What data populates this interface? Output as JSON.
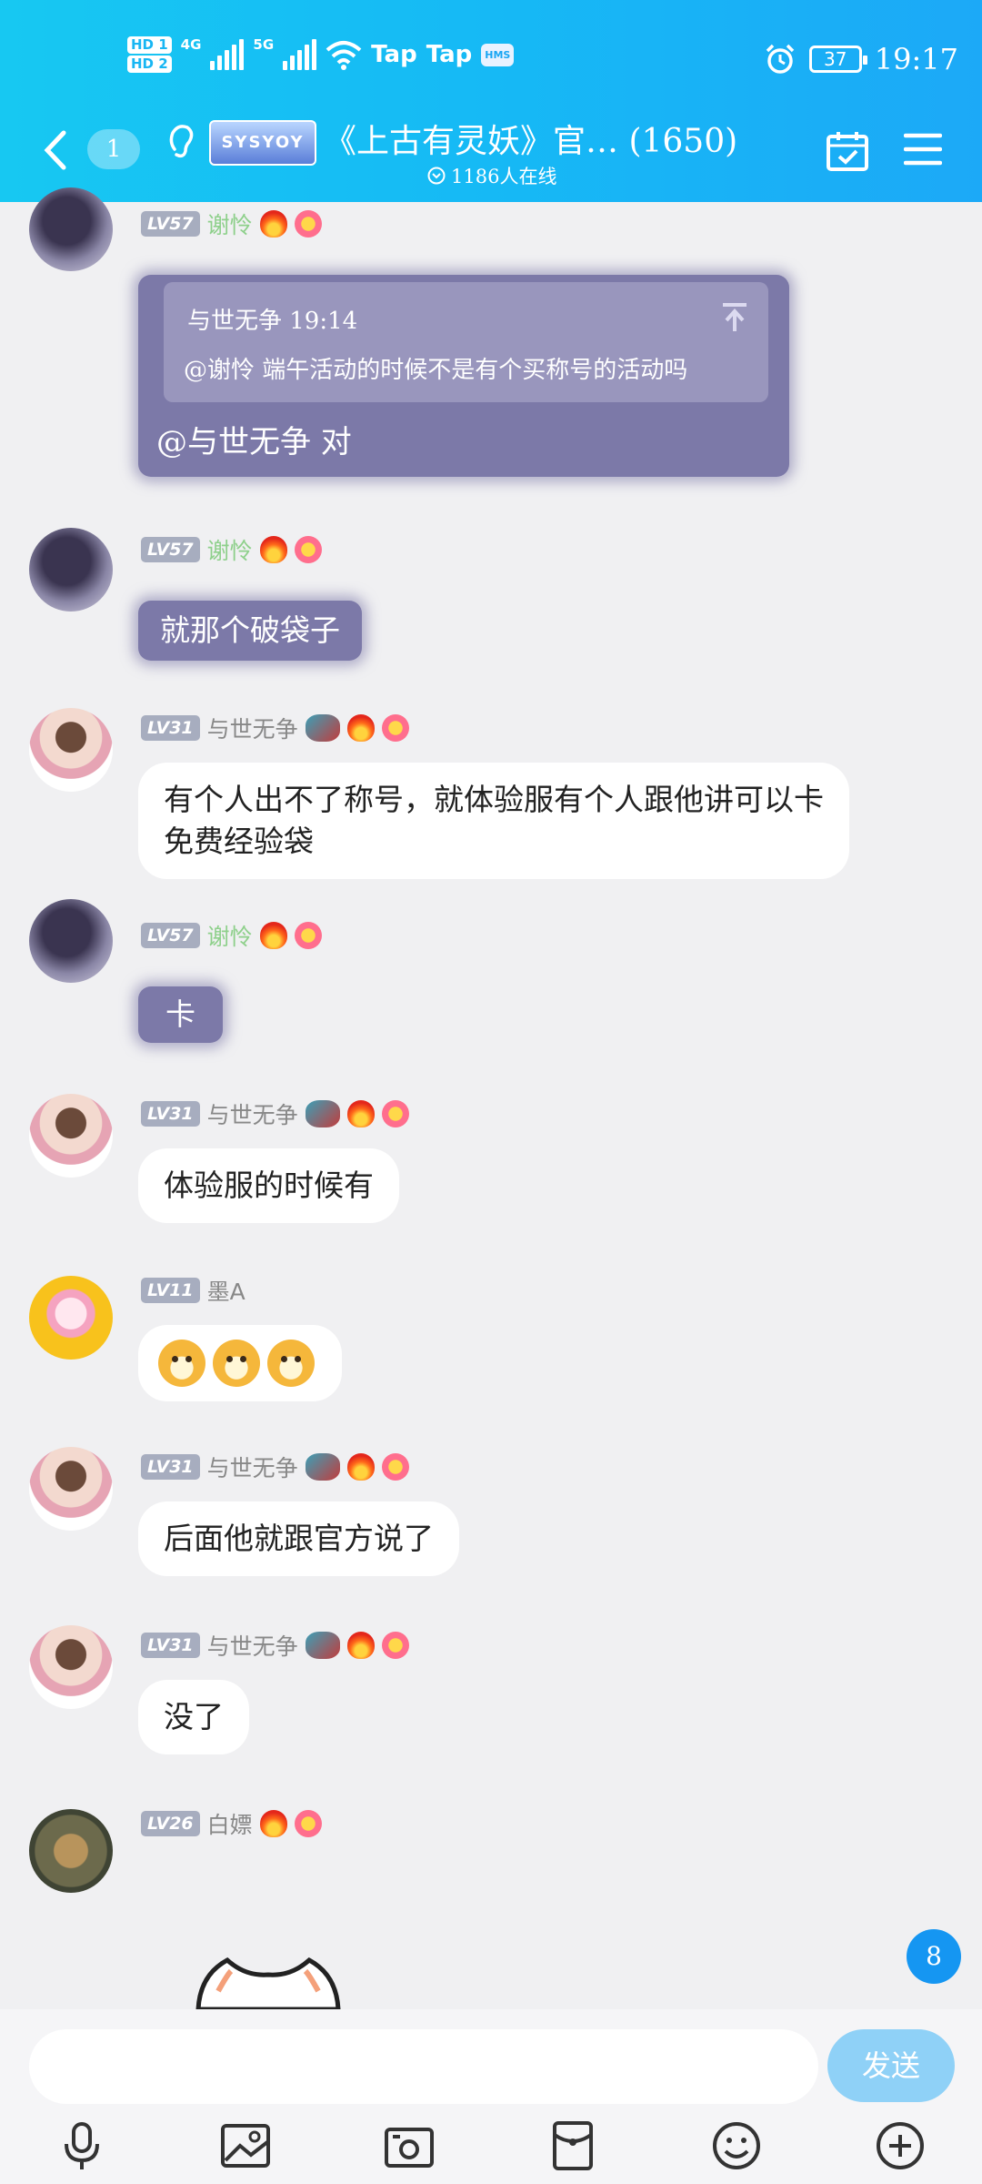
{
  "status_bar": {
    "hd1": "HD 1",
    "hd2": "HD 2",
    "net1": "4G",
    "net2": "5G",
    "app1": "Tap",
    "app2": "Tap",
    "hms": "HMS",
    "battery": "37",
    "time": "19:17"
  },
  "nav": {
    "unread_count": "1",
    "logo_text": "SYSYOY",
    "title": "《上古有灵妖》官… (1650)",
    "online": "1186人在线"
  },
  "colors": {
    "header": "#17c0f4",
    "purple_bubble": "#7c79a8",
    "send_button": "#8fd1f7",
    "badge": "#1596f2"
  },
  "messages": [
    {
      "level": "LV57",
      "name": "谢怜",
      "quote_header": "与世无争  19:14",
      "quote_text": "@谢怜  端午活动的时候不是有个买称号的活动吗",
      "text": "@与世无争 对"
    },
    {
      "level": "LV57",
      "name": "谢怜",
      "text": "就那个破袋子"
    },
    {
      "level": "LV31",
      "name": "与世无争",
      "text": "有个人出不了称号，就体验服有个人跟他讲可以卡免费经验袋"
    },
    {
      "level": "LV57",
      "name": "谢怜",
      "text": "卡"
    },
    {
      "level": "LV31",
      "name": "与世无争",
      "text": "体验服的时候有"
    },
    {
      "level": "LV11",
      "name": "墨A",
      "emoji_count": 3
    },
    {
      "level": "LV31",
      "name": "与世无争",
      "text": "后面他就跟官方说了"
    },
    {
      "level": "LV31",
      "name": "与世无争",
      "text": "没了"
    },
    {
      "level": "LV26",
      "name": "白嫖"
    }
  ],
  "new_message_badge": "8",
  "input": {
    "placeholder": "",
    "send_label": "发送"
  },
  "toolbar_icons": [
    "microphone-icon",
    "image-icon",
    "camera-icon",
    "red-packet-icon",
    "emoji-icon",
    "plus-icon"
  ]
}
